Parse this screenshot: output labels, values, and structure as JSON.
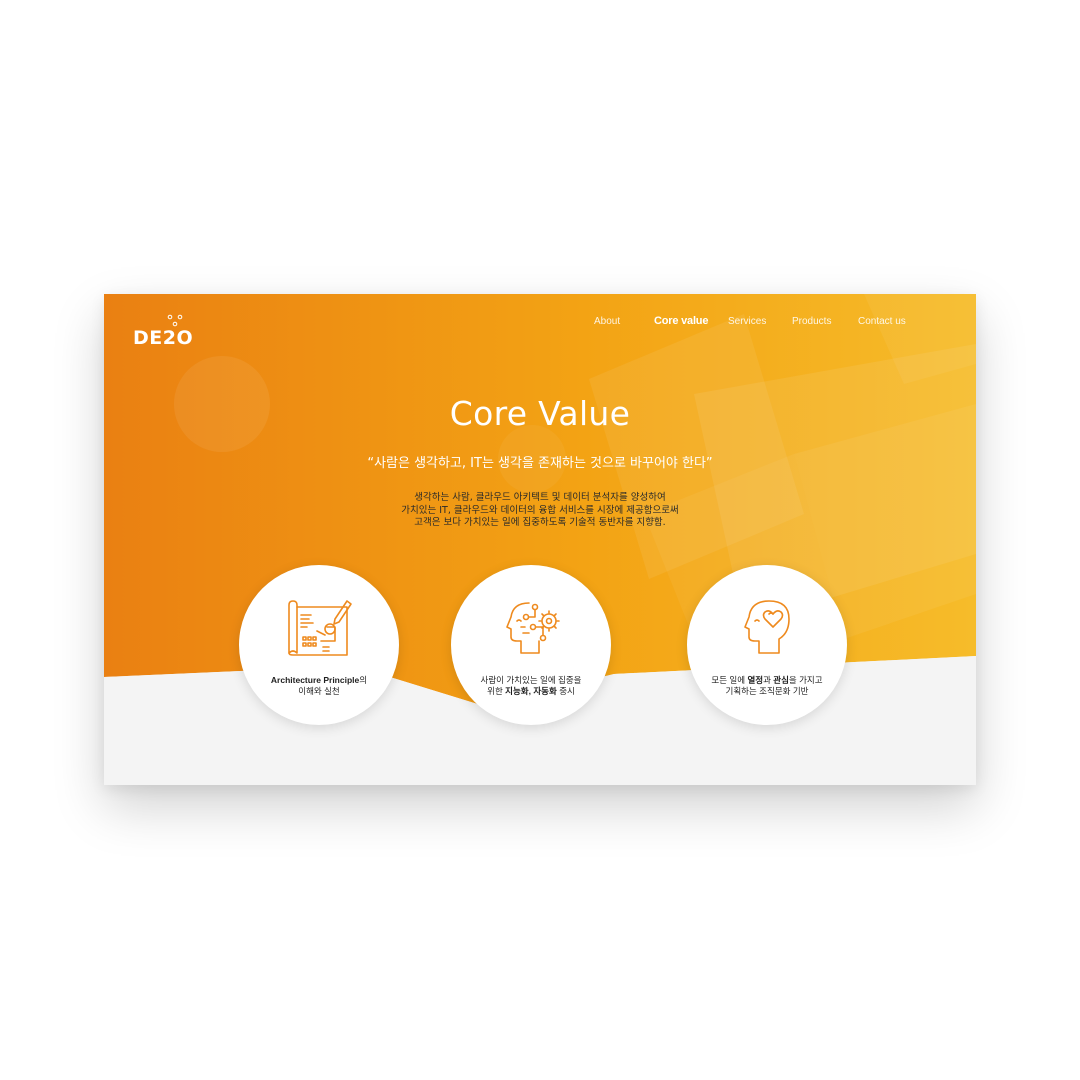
{
  "brand": {
    "logo_text": "DE2O",
    "logo_alt": "DE2O"
  },
  "nav": {
    "items": [
      {
        "label": "About"
      },
      {
        "label": "Core value"
      },
      {
        "label": "Services"
      },
      {
        "label": "Products"
      },
      {
        "label": "Contact us"
      }
    ],
    "active": "Core value"
  },
  "hero": {
    "title": "Core Value",
    "quote": "“사람은 생각하고, IT는 생각을 존재하는 것으로 바꾸어야 한다”",
    "description_lines": [
      "생각하는 사람, 클라우드 아키텍트 및 데이터 분석자를 양성하여",
      "가치있는 IT, 클라우드와 데이터의 융합 서비스를 시장에 제공함으로써",
      "고객은 보다 가치있는 일에 집중하도록 기술적 동반자를 지향함."
    ]
  },
  "values": [
    {
      "icon": "blueprint-icon",
      "line1_bold": "Architecture Principle",
      "line1_rest": "의",
      "line2": "이해와 실천"
    },
    {
      "icon": "head-gear-icon",
      "line1": "사람이 가치있는 일에 집중을",
      "line2_pre": "위한 ",
      "line2_bold": "지능화, 자동화",
      "line2_post": " 중시"
    },
    {
      "icon": "head-heart-icon",
      "line1_pre": "모든 일에 ",
      "line1_bold1": "열정",
      "line1_mid": "과 ",
      "line1_bold2": "관심",
      "line1_post": "을 가지고",
      "line2": "기획하는 조직문화 기반"
    }
  ],
  "colors": {
    "gradient_start": "#ea8012",
    "gradient_end": "#f6b823",
    "icon_stroke": "#ee8a1e",
    "lower_bg": "#f4f4f4"
  }
}
